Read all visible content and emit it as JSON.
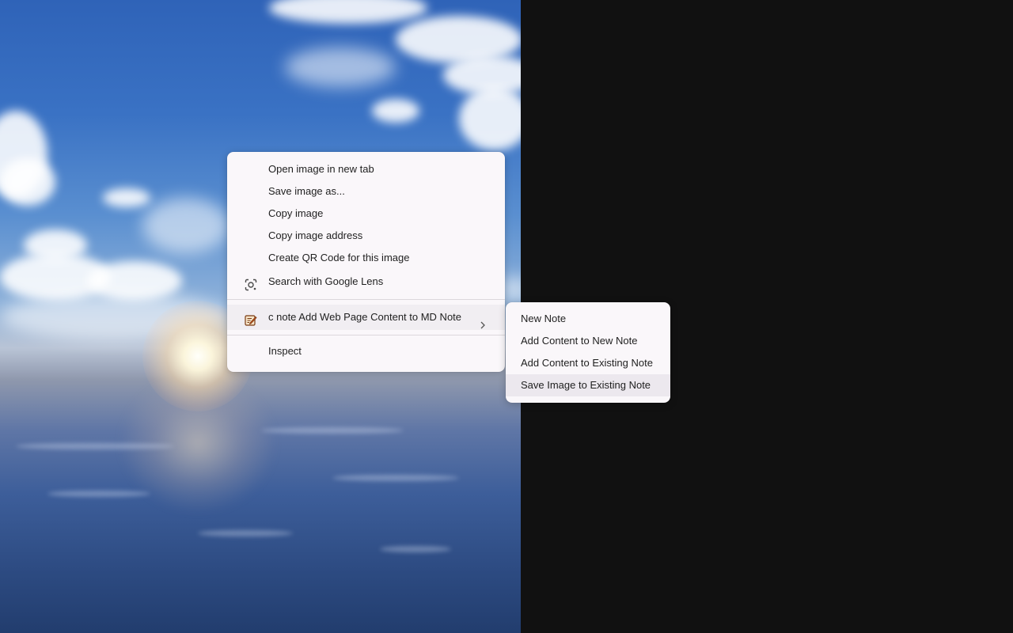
{
  "context_menu": {
    "items": [
      {
        "label": "Open image in new tab"
      },
      {
        "label": "Save image as..."
      },
      {
        "label": "Copy image"
      },
      {
        "label": "Copy image address"
      },
      {
        "label": "Create QR Code for this image"
      },
      {
        "label": "Search with Google Lens",
        "icon": "google-lens-icon"
      }
    ],
    "extension_item": {
      "label": "c note Add Web Page Content to MD Note",
      "icon": "md-note-extension-icon"
    },
    "inspect_label": "Inspect"
  },
  "submenu": {
    "items": [
      {
        "label": "New Note"
      },
      {
        "label": "Add Content to New Note"
      },
      {
        "label": "Add Content to Existing Note"
      },
      {
        "label": "Save Image to Existing Note",
        "highlighted": true
      }
    ]
  },
  "colors": {
    "menu_background": "#faf7fa",
    "highlight": "#ece8ee",
    "text": "#1f1f1f",
    "dark_background": "#111111"
  }
}
